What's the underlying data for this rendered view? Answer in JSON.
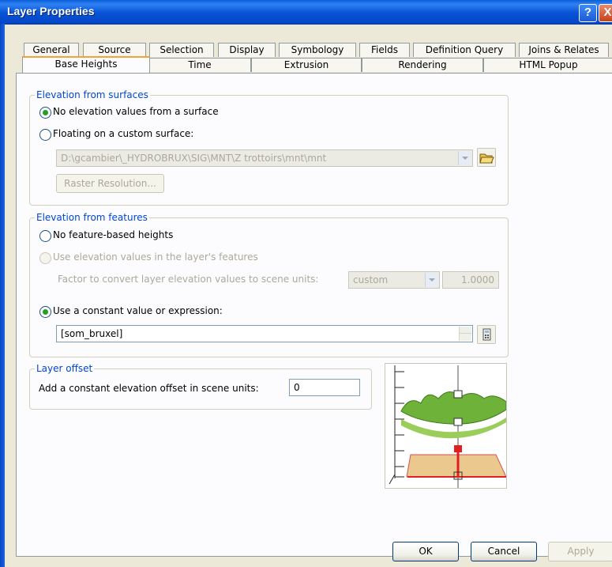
{
  "window": {
    "title": "Layer Properties",
    "help_glyph": "?",
    "close_glyph": "X"
  },
  "tabs": {
    "row1": [
      "General",
      "Source",
      "Selection",
      "Display",
      "Symbology",
      "Fields",
      "Definition Query",
      "Joins & Relates"
    ],
    "row2": [
      "Base Heights",
      "Time",
      "Extrusion",
      "Rendering",
      "HTML Popup"
    ],
    "active": "Base Heights"
  },
  "surfaces": {
    "legend": "Elevation from surfaces",
    "no_surface": "No elevation values from a surface",
    "floating": "Floating on a custom surface:",
    "surface_path": "D:\\gcambier\\_HYDROBRUX\\SIG\\MNT\\Z trottoirs\\mnt\\mnt",
    "raster_button": "Raster Resolution...",
    "selected": "no_surface"
  },
  "features": {
    "legend": "Elevation from features",
    "no_heights": "No feature-based heights",
    "use_values": "Use elevation values in the layer's features",
    "factor_label": "Factor to convert layer elevation values to scene units:",
    "factor_unit": "custom",
    "factor_value": "1.0000",
    "constant": "Use a constant value or expression:",
    "expression": "[som_bruxel]",
    "selected": "constant"
  },
  "offset": {
    "legend": "Layer offset",
    "label": "Add a constant elevation offset in scene units:",
    "value": "0"
  },
  "buttons": {
    "ok": "OK",
    "cancel": "Cancel",
    "apply": "Apply"
  },
  "colors": {
    "accent": "#0046D5",
    "radio_dot": "#21A121",
    "title_bar": "#0753D6"
  }
}
